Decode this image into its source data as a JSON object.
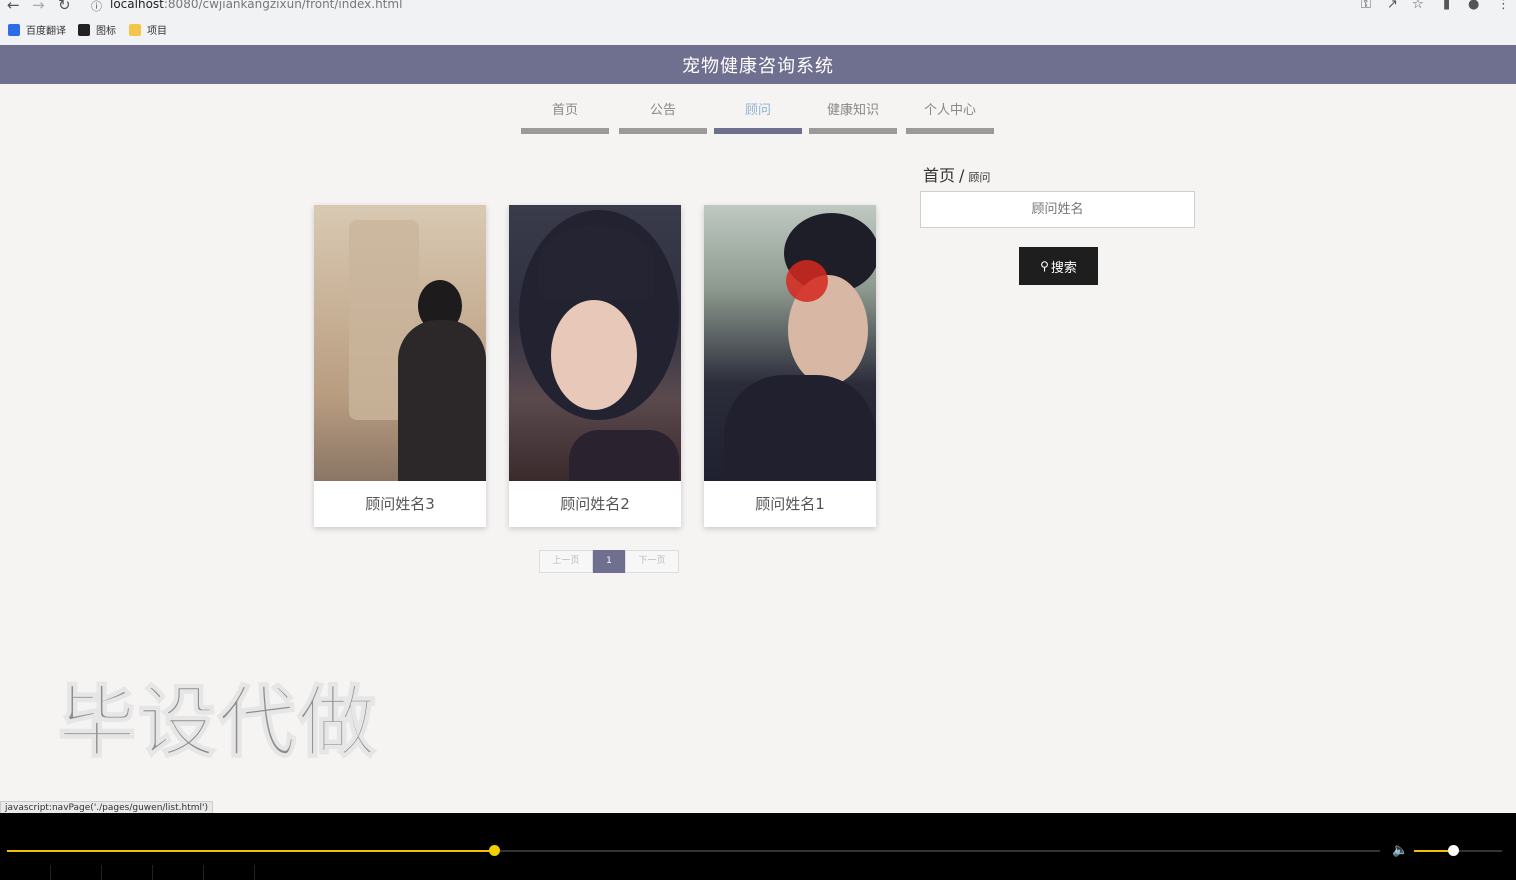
{
  "browser": {
    "url_host": "localhost",
    "url_path": ":8080/cwjiankangzixun/front/index.html",
    "bookmarks": [
      {
        "label": "百度翻译",
        "color": "#2d6ce8"
      },
      {
        "label": "图标",
        "color": "#222222"
      },
      {
        "label": "项目",
        "color": "#f3c64b"
      }
    ]
  },
  "site": {
    "title": "宠物健康咨询系统",
    "header_color": "#6f6f8f"
  },
  "nav": {
    "items": [
      {
        "label": "首页",
        "active": false
      },
      {
        "label": "公告",
        "active": false
      },
      {
        "label": "顾问",
        "active": true
      },
      {
        "label": "健康知识",
        "active": false
      },
      {
        "label": "个人中心",
        "active": false
      }
    ]
  },
  "cards": [
    {
      "name": "顾问姓名3"
    },
    {
      "name": "顾问姓名2"
    },
    {
      "name": "顾问姓名1"
    }
  ],
  "pagination": {
    "prev": "上一页",
    "current": "1",
    "next": "下一页"
  },
  "breadcrumb": {
    "home": "首页",
    "separator": "/",
    "current": "顾问"
  },
  "search": {
    "placeholder": "顾问姓名",
    "button_label": "搜索"
  },
  "watermark": "毕设代做",
  "status_text": "javascript:navPage('./pages/guwen/list.html')",
  "player": {
    "progress": 0.355,
    "volume": 0.44,
    "accent": "#f2c200"
  }
}
